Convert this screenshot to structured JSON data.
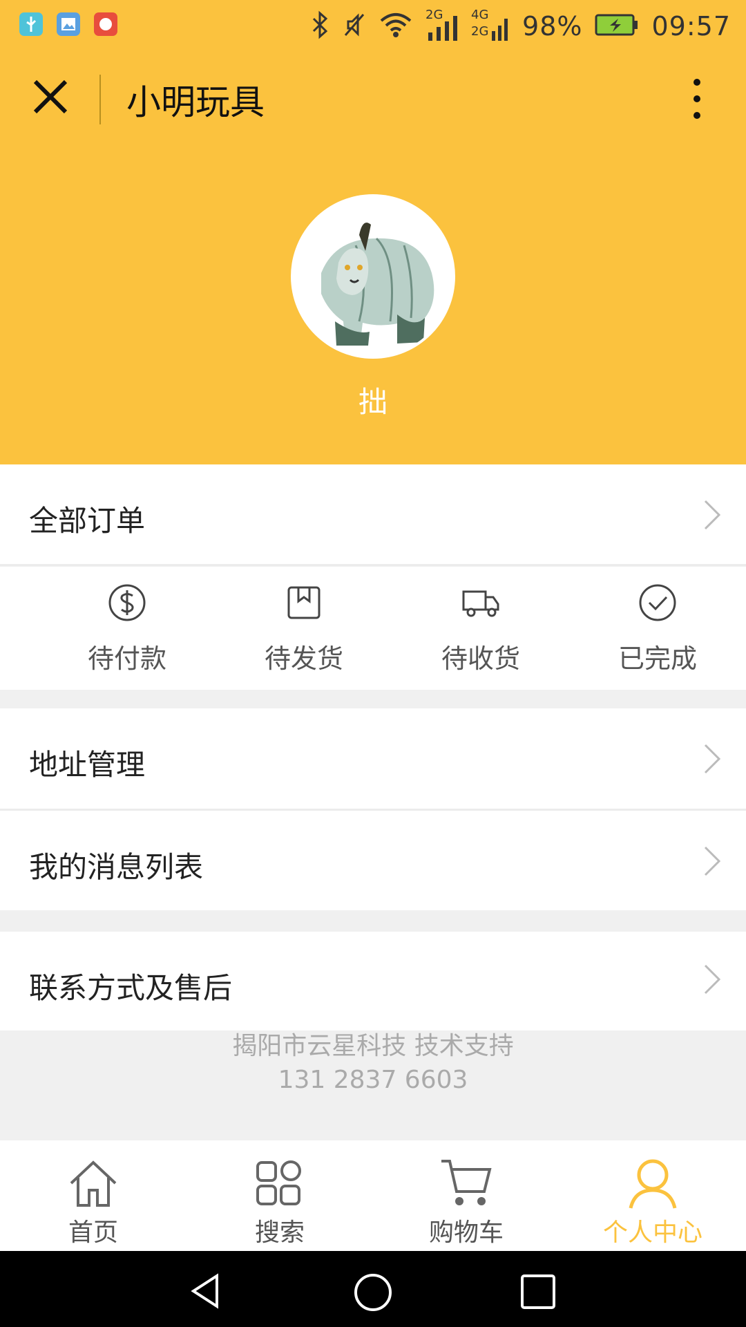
{
  "status_bar": {
    "signal_2g": "2G",
    "signal_4g": "4G",
    "signal_2g_b": "2G",
    "battery": "98%",
    "time": "09:57"
  },
  "title_bar": {
    "title": "小明玩具",
    "close_icon": "close-icon",
    "more_icon": "more-vertical-icon"
  },
  "profile": {
    "username": "拙"
  },
  "menu": {
    "all_orders": "全部订单",
    "address": "地址管理",
    "messages": "我的消息列表",
    "contact": "联系方式及售后"
  },
  "order_status": [
    {
      "label": "待付款",
      "icon": "dollar-circle-icon"
    },
    {
      "label": "待发货",
      "icon": "package-icon"
    },
    {
      "label": "待收货",
      "icon": "truck-icon"
    },
    {
      "label": "已完成",
      "icon": "check-circle-icon"
    }
  ],
  "footer": {
    "support": "揭阳市云星科技 技术支持",
    "phone": "131 2837 6603"
  },
  "tabbar": [
    {
      "label": "首页",
      "icon": "home-icon"
    },
    {
      "label": "搜索",
      "icon": "search-grid-icon"
    },
    {
      "label": "购物车",
      "icon": "cart-icon"
    },
    {
      "label": "个人中心",
      "icon": "user-icon",
      "active": true
    }
  ],
  "colors": {
    "accent": "#fbc23e",
    "background": "#f0f0f0"
  }
}
